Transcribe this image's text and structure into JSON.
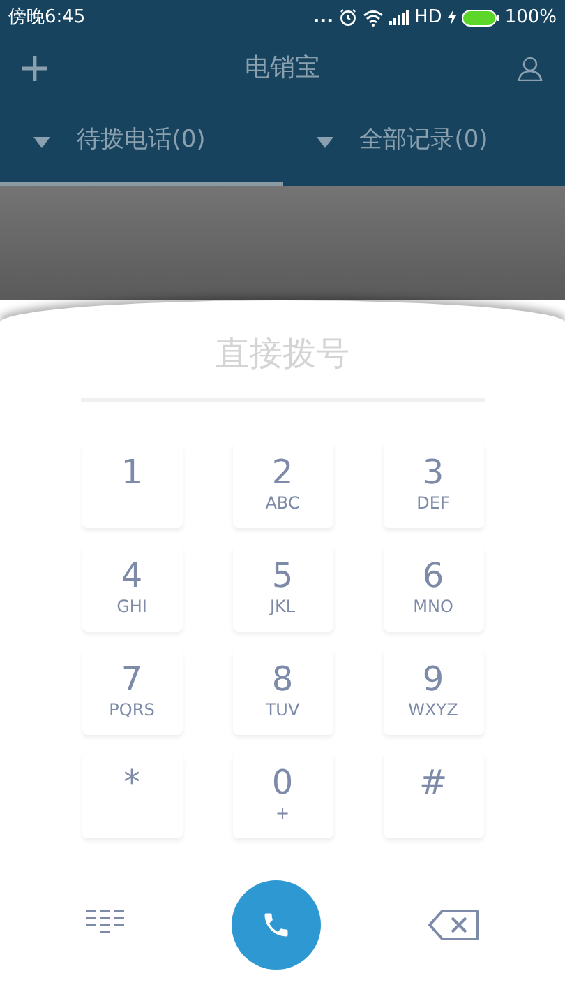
{
  "status_bar": {
    "time": "傍晚6:45",
    "dots": "...",
    "network": "HD",
    "battery_text": "100%"
  },
  "header": {
    "title": "电销宝"
  },
  "tabs": [
    {
      "label": "待拨电话(0)",
      "selected": true
    },
    {
      "label": "全部记录(0)",
      "selected": false
    }
  ],
  "dial_field": {
    "placeholder": "直接拨号"
  },
  "keys": [
    {
      "digit": "1"
    },
    {
      "digit": "2",
      "letters": "ABC"
    },
    {
      "digit": "3",
      "letters": "DEF"
    },
    {
      "digit": "4",
      "letters": "GHI"
    },
    {
      "digit": "5",
      "letters": "JKL"
    },
    {
      "digit": "6",
      "letters": "MNO"
    },
    {
      "digit": "7",
      "letters": "PQRS"
    },
    {
      "digit": "8",
      "letters": "TUV"
    },
    {
      "digit": "9",
      "letters": "WXYZ"
    },
    {
      "digit": "*"
    },
    {
      "digit": "0",
      "letters": "+"
    },
    {
      "digit": "#"
    }
  ]
}
